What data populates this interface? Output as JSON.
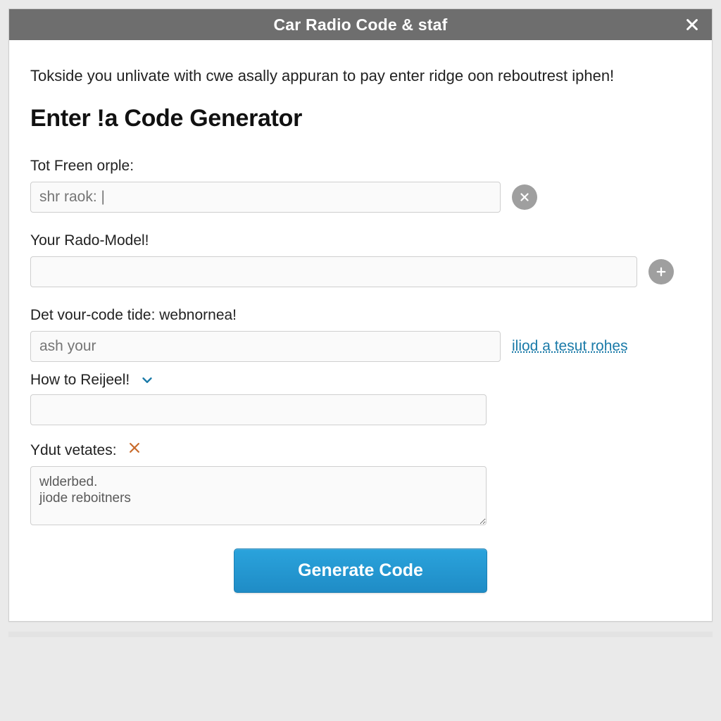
{
  "titlebar": {
    "title": "Car Radio Code & staf",
    "close_icon": "close-icon"
  },
  "intro": "Tokside you unlivate with cwe asally appuran to pay enter ridge oon reboutrest iphen!",
  "section_title": "Enter !a Code Generator",
  "fields": {
    "f1": {
      "label": "Tot Freen orple:",
      "placeholder": "shr raok: |",
      "clear_icon": "x-icon"
    },
    "f2": {
      "label": "Your Rado-Model!",
      "placeholder": "",
      "add_icon": "plus-icon"
    },
    "f3": {
      "label": "Det vour-code tide: webnornea!",
      "placeholder": "ash your",
      "side_link": "iliod a tesut rohes",
      "how_label": "How to Reijeel!  ",
      "chevron_icon": "chevron-down-icon"
    },
    "f4": {
      "label_text": "Ydut vetates:",
      "inline_x_icon": "x-orange-icon",
      "textarea_value": "wlderbed.\njiode reboitners"
    }
  },
  "submit": {
    "label": "Generate Code"
  }
}
